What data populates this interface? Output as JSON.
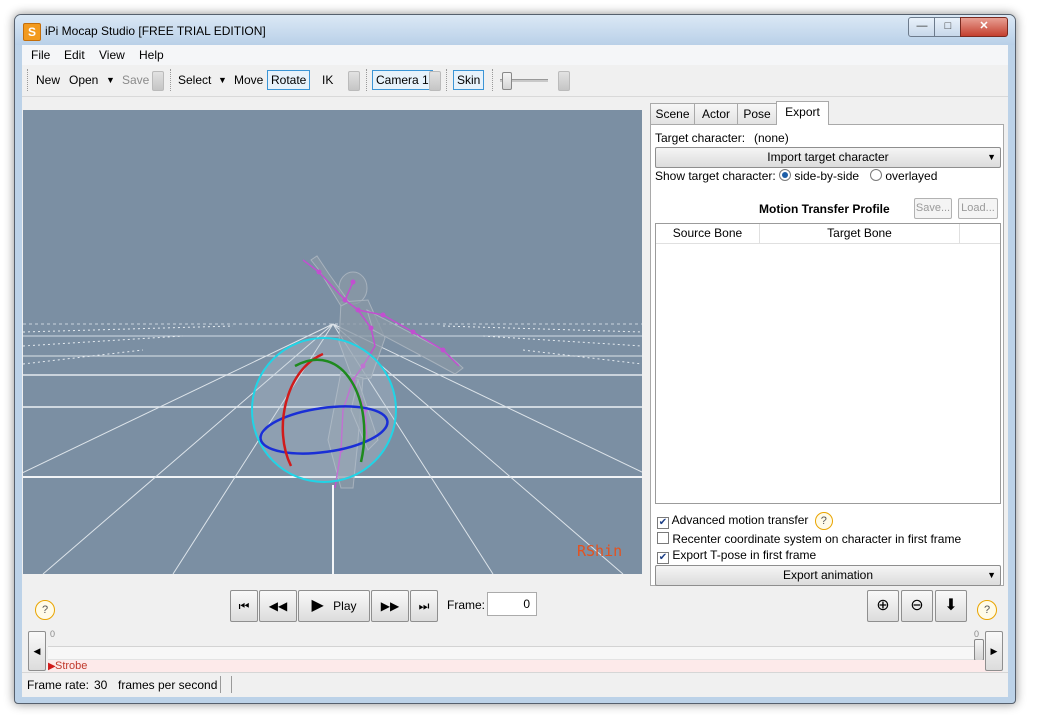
{
  "window": {
    "title": "iPi Mocap Studio [FREE TRIAL EDITION]",
    "app_icon": "S",
    "controls": {
      "minimize": "—",
      "maximize": "□",
      "close": "✕"
    }
  },
  "menu": {
    "items": [
      "File",
      "Edit",
      "View",
      "Help"
    ]
  },
  "toolbar": {
    "new": "New",
    "open": "Open",
    "open_arrow": "▼",
    "save": "Save",
    "select": "Select",
    "select_arrow": "▼",
    "move": "Move",
    "rotate": "Rotate",
    "ik": "IK",
    "camera": "Camera 1",
    "skin": "Skin",
    "slider_level": 0.05
  },
  "viewport": {
    "label": "RShin"
  },
  "right_panel": {
    "tabs": [
      "Scene",
      "Actor",
      "Pose",
      "Export"
    ],
    "active_tab": "Export",
    "target_character_label": "Target character:",
    "target_character_value": "(none)",
    "import_button": "Import target character",
    "import_arrow": "▼",
    "show_target_label": "Show target character:",
    "radio_side_by_side": "side-by-side",
    "radio_overlayed": "overlayed",
    "profile_title": "Motion Transfer Profile",
    "profile_save": "Save...",
    "profile_load": "Load...",
    "grid_headers": [
      "Source Bone",
      "Target Bone"
    ],
    "checkbox_advanced": "Advanced motion transfer",
    "checkbox_recenter": "Recenter coordinate system on character in first frame",
    "checkbox_tpose": "Export T-pose in first frame",
    "checkbox_advanced_checked": true,
    "checkbox_recenter_checked": false,
    "checkbox_tpose_checked": true,
    "export_button": "Export animation",
    "export_arrow": "▼",
    "help_glyph": "?"
  },
  "playback": {
    "first_glyph": "⏮",
    "rewind_glyph": "◀◀",
    "play_glyph": "▶",
    "play_label": "Play",
    "forward_glyph": "▶▶",
    "last_glyph": "⏭",
    "frame_label": "Frame:",
    "frame_value": "0",
    "help_glyph": "?",
    "zoom_in_glyph": "⊕",
    "zoom_out_glyph": "⊖",
    "down_glyph": "⬇"
  },
  "timeline": {
    "start_tick": "0",
    "end_tick": "0",
    "left_arrow": "◀",
    "right_arrow": "▶",
    "strobe_label": "Strobe"
  },
  "status": {
    "frame_rate_label": "Frame rate:",
    "frame_rate_value": "30",
    "frame_rate_unit": "frames per second"
  },
  "colors": {
    "viewport_bg": "#7b8fa3",
    "accent_border": "#3b95d6",
    "label_color": "#e4521f",
    "gizmo_cyan": "#21d4e6",
    "gizmo_red": "#d11b1b",
    "gizmo_green": "#1e8a1e",
    "gizmo_blue": "#1a2fd6",
    "skeleton": "#c24fd0"
  },
  "icons": {
    "window_minimize": "minimize-icon",
    "window_maximize": "maximize-icon",
    "window_close": "close-icon",
    "zoom_in": "zoom-in-icon",
    "zoom_out": "zoom-out-icon",
    "down": "arrow-down-icon",
    "help": "help-icon"
  }
}
